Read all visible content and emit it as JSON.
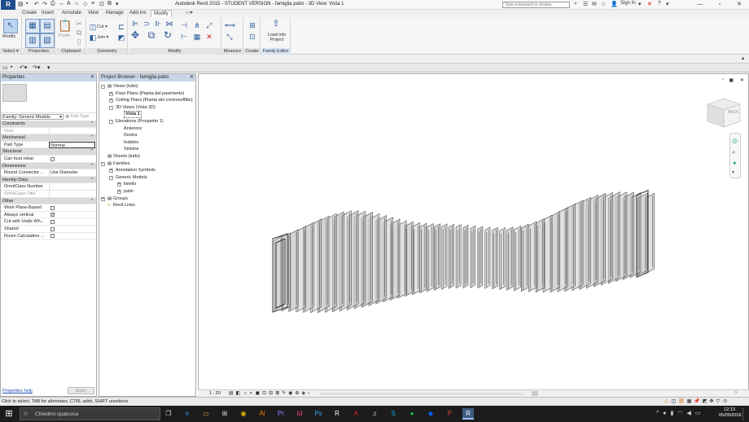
{
  "window": {
    "title": "Autodesk Revit 2015 -  STUDENT VERSION -    famiglia patio - 3D View: Vista 1",
    "search_placeholder": "Type a keyword or phrase",
    "sign_in": "Sign In",
    "help_glyph": "?"
  },
  "tabs": [
    "Create",
    "Insert",
    "Annotate",
    "View",
    "Manage",
    "Add-Ins",
    "Modify"
  ],
  "active_tab": "Modify",
  "ribbon": {
    "modify_label": "Modify",
    "cut_label": "Cut",
    "join_label": "Join",
    "paste_label": "Paste",
    "measure_label": "Measure",
    "load_into_project_label": "Load into Project",
    "panels": {
      "select": "Select",
      "properties": "Properties",
      "clipboard": "Clipboard",
      "geometry": "Geometry",
      "modify": "Modify",
      "measure": "Measure",
      "create": "Create",
      "family_editor": "Family Editor"
    }
  },
  "properties": {
    "header": "Properties",
    "family_selector": "Family: Generic Models",
    "edit_type": "Edit Type",
    "rows": [
      {
        "type": "section",
        "label": "Constraints"
      },
      {
        "type": "row",
        "key": "Host",
        "value": "",
        "grey": true
      },
      {
        "type": "section",
        "label": "Mechanical"
      },
      {
        "type": "row",
        "key": "Part Type",
        "value": "Normal"
      },
      {
        "type": "section",
        "label": "Structural"
      },
      {
        "type": "check",
        "key": "Can host rebar",
        "checked": false
      },
      {
        "type": "section",
        "label": "Dimensions"
      },
      {
        "type": "row",
        "key": "Round Connector ...",
        "value": "Use Diameter"
      },
      {
        "type": "section",
        "label": "Identity Data"
      },
      {
        "type": "row",
        "key": "OmniClass Number",
        "value": ""
      },
      {
        "type": "row",
        "key": "OmniClass Title",
        "value": "",
        "grey": true
      },
      {
        "type": "section",
        "label": "Other"
      },
      {
        "type": "check",
        "key": "Work Plane-Based",
        "checked": false
      },
      {
        "type": "check",
        "key": "Always vertical",
        "checked": true
      },
      {
        "type": "check",
        "key": "Cut with Voids Wh...",
        "checked": false
      },
      {
        "type": "check",
        "key": "Shared",
        "checked": false
      },
      {
        "type": "check",
        "key": "Room Calculation ...",
        "checked": false
      }
    ],
    "help_link": "Properties help",
    "apply": "Apply"
  },
  "browser": {
    "header": "Project Browser - famiglia patio",
    "nodes": [
      {
        "label": "Views (tutto)",
        "level": 0,
        "exp": "-",
        "icon": true
      },
      {
        "label": "Floor Plans (Pianta del pavimento)",
        "level": 1,
        "exp": "+"
      },
      {
        "label": "Ceiling Plans (Pianta del controsoffitto)",
        "level": 1,
        "exp": "+"
      },
      {
        "label": "3D Views (Vista 3D)",
        "level": 1,
        "exp": "-"
      },
      {
        "label": "Vista 1",
        "level": 2,
        "bold": true
      },
      {
        "label": "Elevations (Prospetto 1)",
        "level": 1,
        "exp": "-"
      },
      {
        "label": "Anteriore",
        "level": 2
      },
      {
        "label": "Destra",
        "level": 2
      },
      {
        "label": "Indietro",
        "level": 2
      },
      {
        "label": "Sinistra",
        "level": 2
      },
      {
        "label": "Sheets (tutto)",
        "level": 0,
        "exp": "",
        "icon": true
      },
      {
        "label": "Families",
        "level": 0,
        "exp": "-",
        "icon": true
      },
      {
        "label": "Annotation Symbols",
        "level": 1,
        "exp": "+"
      },
      {
        "label": "Generic Models",
        "level": 1,
        "exp": "-"
      },
      {
        "label": "listello",
        "level": 2,
        "exp": "+"
      },
      {
        "label": "patio",
        "level": 2,
        "exp": "+"
      },
      {
        "label": "Groups",
        "level": 0,
        "exp": "+",
        "icon": true
      },
      {
        "label": "Revit Links",
        "level": 0,
        "exp": "",
        "icon": true
      }
    ]
  },
  "viewcube": {
    "face": "BACK"
  },
  "view_controls": {
    "scale": "1 : 20"
  },
  "status": {
    "text": "Click to select, TAB for alternates, CTRL adds, SHIFT unselects.",
    "zero": ":0"
  },
  "taskbar": {
    "search_placeholder": "Chiedimi qualcosa",
    "clock_time": "12:13",
    "clock_date": "05/05/2016",
    "apps": [
      "task-view",
      "edge",
      "explorer",
      "store",
      "chrome",
      "illustrator",
      "premiere",
      "indesign",
      "photoshop",
      "revit",
      "acrobat",
      "itunes",
      "skype",
      "spotify",
      "dropbox",
      "powerpoint",
      "revit-active"
    ]
  }
}
